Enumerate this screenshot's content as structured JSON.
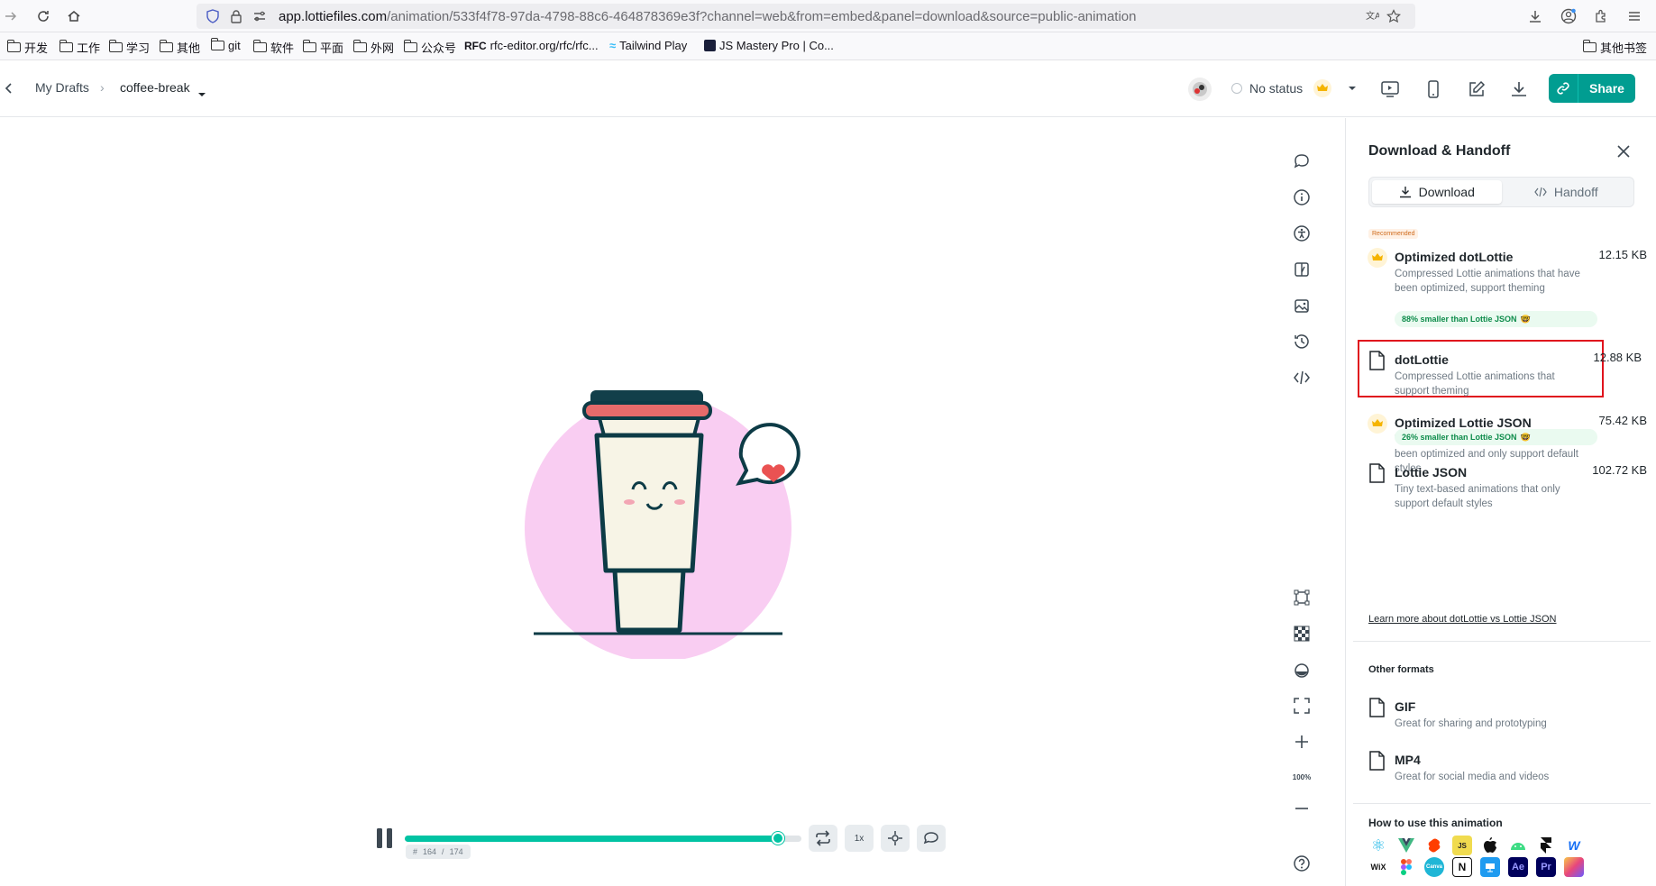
{
  "browser": {
    "url_host": "app.lottiefiles.com",
    "url_path": "/animation/533f4f78-97da-4798-88c6-464878369e3f?channel=web&from=embed&panel=download&source=public-animation",
    "bookmarks": [
      "开发",
      "工作",
      "学习",
      "其他",
      "git",
      "软件",
      "平面",
      "外网",
      "公众号",
      "rfc-editor.org/rfc/rfc...",
      "Tailwind Play",
      "JS Mastery Pro | Co..."
    ],
    "other_bookmarks": "其他书签"
  },
  "header": {
    "breadcrumb_parent": "My Drafts",
    "file_name": "coffee-break",
    "status": "No status",
    "share_label": "Share"
  },
  "player": {
    "speed_label": "1x",
    "frame_current": "164",
    "frame_total": "174",
    "frame_separator": "/",
    "frame_prefix": "#",
    "progress": 0.94,
    "zoom": "100%"
  },
  "panel": {
    "title": "Download & Handoff",
    "tabs": [
      {
        "label": "Download"
      },
      {
        "label": "Handoff"
      }
    ],
    "recommended_badge": "Recommended",
    "formats": [
      {
        "title": "Optimized dotLottie",
        "size": "12.15 KB",
        "desc": "Compressed Lottie animations that have been optimized, support theming",
        "savings": "88% smaller than Lottie JSON"
      },
      {
        "title": "dotLottie",
        "size": "12.88 KB",
        "desc": "Compressed Lottie animations that support theming"
      },
      {
        "title": "Optimized Lottie JSON",
        "size": "75.42 KB",
        "desc": "Tiny text-based animations that have been optimized and only support default styles",
        "savings": "26% smaller than Lottie JSON"
      },
      {
        "title": "Lottie JSON",
        "size": "102.72 KB",
        "desc": "Tiny text-based animations that only support default styles"
      }
    ],
    "learn_more": "Learn more about dotLottie vs Lottie JSON",
    "other_formats_title": "Other formats",
    "other_formats": [
      {
        "title": "GIF",
        "desc": "Great for sharing and prototyping"
      },
      {
        "title": "MP4",
        "desc": "Great for social media and videos"
      }
    ],
    "how_to_title": "How to use this animation",
    "app_logos_row1": [
      "react-logo",
      "vue-logo",
      "svelte-logo",
      "js-logo",
      "apple-logo",
      "android-logo",
      "framer-logo",
      "webflow-logo"
    ],
    "app_logos_row2": [
      "wix-logo",
      "figma-logo",
      "canva-logo",
      "notion-logo",
      "keynote-logo",
      "after-effects-logo",
      "premiere-logo",
      "final-cut-logo"
    ],
    "logo_text": {
      "js": "JS",
      "wix": "WiX",
      "ae": "Ae",
      "pr": "Pr",
      "canva": "Canva",
      "notion": "N"
    }
  },
  "colors": {
    "accent": "#019d91",
    "progress": "#01c3a3",
    "highlight": "#e0131d",
    "illustration_bg": "#f9cdf2"
  }
}
